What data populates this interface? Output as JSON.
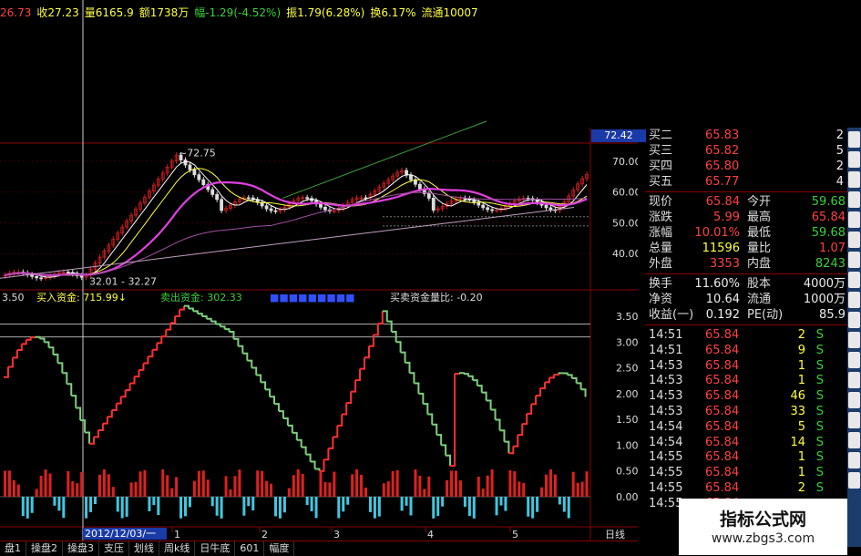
{
  "header": {
    "items": [
      {
        "text": "26.73",
        "color": "#ff4040"
      },
      {
        "text": "收27.23",
        "color": "#ffff40"
      },
      {
        "text": "量6165.9",
        "color": "#ffff40"
      },
      {
        "text": "额1738万",
        "color": "#ffff40"
      },
      {
        "text": "幅-1.29(-4.52%)",
        "color": "#39d039"
      },
      {
        "text": "振1.79(6.28%)",
        "color": "#ffff40"
      },
      {
        "text": "换6.17%",
        "color": "#ffff40"
      },
      {
        "text": "流通10007",
        "color": "#ffff40"
      }
    ]
  },
  "chart": {
    "price_tag": "72.42",
    "high_label": "72.75",
    "low_label": "32.01 - 32.27",
    "price_axis": [
      "70.00",
      "60.00",
      "50.00",
      "40.00"
    ],
    "indicator_axis": [
      "3.50",
      "3.00",
      "2.50",
      "2.00",
      "1.50",
      "1.00",
      "0.50",
      "0.00"
    ],
    "indicator_header": {
      "value": "3.50",
      "buy_label": "买入资金: 715.99↓",
      "sell_label": "卖出资金: 302.33",
      "hidden": "■■■■■■■■■",
      "ratio_label": "买卖资金量比: -0.20"
    },
    "date_label": "2012/12/03/一",
    "months": [
      "1",
      "2",
      "3",
      "4",
      "5"
    ],
    "period": "日线"
  },
  "quote": {
    "bids": [
      {
        "label": "买二",
        "price": "65.83",
        "vol": "2"
      },
      {
        "label": "买三",
        "price": "65.82",
        "vol": "5"
      },
      {
        "label": "买四",
        "price": "65.80",
        "vol": "2"
      },
      {
        "label": "买五",
        "price": "65.77",
        "vol": "4"
      }
    ],
    "stats": [
      {
        "l1": "现价",
        "v1": "65.84",
        "c1": "red",
        "l2": "今开",
        "v2": "59.68",
        "c2": "green"
      },
      {
        "l1": "涨跌",
        "v1": "5.99",
        "c1": "red",
        "l2": "最高",
        "v2": "65.84",
        "c2": "red"
      },
      {
        "l1": "涨幅",
        "v1": "10.01%",
        "c1": "red",
        "l2": "最低",
        "v2": "59.68",
        "c2": "green"
      },
      {
        "l1": "总量",
        "v1": "11596",
        "c1": "yellow",
        "l2": "量比",
        "v2": "1.07",
        "c2": "red"
      },
      {
        "l1": "外盘",
        "v1": "3353",
        "c1": "red",
        "l2": "内盘",
        "v2": "8243",
        "c2": "green"
      }
    ],
    "fundamentals": [
      {
        "l1": "换手",
        "v1": "11.60%",
        "l2": "股本",
        "v2": "4000万"
      },
      {
        "l1": "净资",
        "v1": "10.64",
        "l2": "流通",
        "v2": "1000万"
      },
      {
        "l1": "收益(一)",
        "v1": "0.192",
        "l2": "PE(动)",
        "v2": "85.9"
      }
    ],
    "ticks": [
      {
        "time": "14:51",
        "price": "65.84",
        "vol": "2",
        "side": "S"
      },
      {
        "time": "14:51",
        "price": "65.84",
        "vol": "9",
        "side": "S"
      },
      {
        "time": "14:53",
        "price": "65.84",
        "vol": "1",
        "side": "S"
      },
      {
        "time": "14:53",
        "price": "65.84",
        "vol": "1",
        "side": "S"
      },
      {
        "time": "14:53",
        "price": "65.84",
        "vol": "46",
        "side": "S"
      },
      {
        "time": "14:53",
        "price": "65.84",
        "vol": "33",
        "side": "S"
      },
      {
        "time": "14:54",
        "price": "65.84",
        "vol": "5",
        "side": "S"
      },
      {
        "time": "14:54",
        "price": "65.84",
        "vol": "14",
        "side": "S"
      },
      {
        "time": "14:55",
        "price": "65.84",
        "vol": "1",
        "side": "S"
      },
      {
        "time": "14:55",
        "price": "65.84",
        "vol": "1",
        "side": "S"
      },
      {
        "time": "14:55",
        "price": "65.84",
        "vol": "2",
        "side": "S"
      },
      {
        "time": "14:55",
        "price": "65.84",
        "vol": "",
        "side": ""
      }
    ]
  },
  "bottom_tabs": [
    "盘1",
    "操盘2",
    "操盘3",
    "支压",
    "划线",
    "周k线",
    "日牛底",
    "601",
    "幅度"
  ],
  "watermark": {
    "title": "指标公式网",
    "url": "www.zbgs3.com"
  },
  "colors": {
    "accent": "#1a3aa8",
    "up": "#ff4040",
    "down": "#39d039",
    "grid": "#8b0000"
  }
}
